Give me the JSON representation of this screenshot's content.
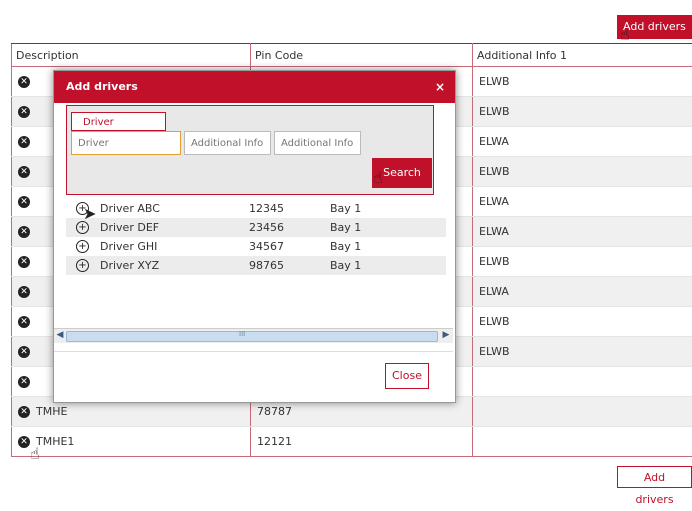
{
  "toolbar": {
    "add_drivers_label": "Add drivers"
  },
  "table": {
    "headers": [
      "Description",
      "Pin Code",
      "Additional Info 1"
    ],
    "rows": [
      {
        "desc": "",
        "pin": "",
        "info": "ELWB"
      },
      {
        "desc": "",
        "pin": "",
        "info": "ELWB"
      },
      {
        "desc": "",
        "pin": "",
        "info": "ELWA"
      },
      {
        "desc": "",
        "pin": "",
        "info": "ELWB"
      },
      {
        "desc": "",
        "pin": "",
        "info": "ELWA"
      },
      {
        "desc": "",
        "pin": "",
        "info": "ELWA"
      },
      {
        "desc": "",
        "pin": "",
        "info": "ELWB"
      },
      {
        "desc": "",
        "pin": "",
        "info": "ELWA"
      },
      {
        "desc": "",
        "pin": "",
        "info": "ELWB"
      },
      {
        "desc": "",
        "pin": "",
        "info": "ELWB"
      },
      {
        "desc": "",
        "pin": "",
        "info": ""
      },
      {
        "desc": "TMHE",
        "pin": "78787",
        "info": ""
      },
      {
        "desc": "TMHE1",
        "pin": "12121",
        "info": ""
      }
    ]
  },
  "modal": {
    "title": "Add drivers",
    "close_glyph": "×",
    "search_tab": "Driver",
    "driver_placeholder": "Driver",
    "info1_placeholder": "Additional Info",
    "info2_placeholder": "Additional Info",
    "search_label": "Search",
    "close_label": "Close",
    "scroll_mark": "III",
    "results": [
      {
        "name": "Driver ABC",
        "pin": "12345",
        "bay": "Bay 1"
      },
      {
        "name": "Driver DEF",
        "pin": "23456",
        "bay": "Bay 1"
      },
      {
        "name": "Driver GHI",
        "pin": "34567",
        "bay": "Bay 1"
      },
      {
        "name": "Driver XYZ",
        "pin": "98765",
        "bay": "Bay 1"
      }
    ]
  },
  "icons": {
    "remove": "x-circle-icon",
    "add": "plus-circle-icon",
    "cursor": "hand-cursor-icon"
  }
}
